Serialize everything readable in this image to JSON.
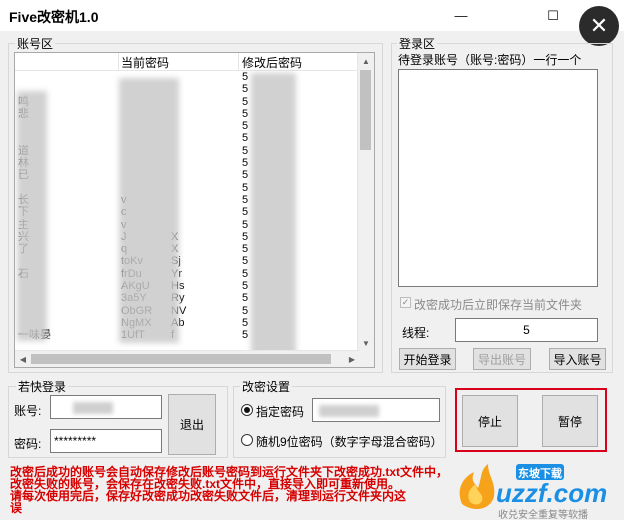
{
  "window": {
    "title": "Five改密机1.0",
    "minimize": "—",
    "maximize": "☐",
    "close": "✕"
  },
  "accounts_group": {
    "label": "账号区",
    "columns": [
      "",
      "当前密码",
      "修改后密码"
    ],
    "rows": [
      [
        "",
        "",
        "5"
      ],
      [
        "",
        "",
        "5"
      ],
      [
        "鸣",
        "",
        "5"
      ],
      [
        "悲",
        "",
        "5"
      ],
      [
        "",
        "",
        "5"
      ],
      [
        "",
        "",
        "5"
      ],
      [
        "道",
        "",
        "5"
      ],
      [
        "林",
        "",
        "5"
      ],
      [
        "已",
        "",
        "5"
      ],
      [
        "",
        "",
        "5"
      ],
      [
        "长",
        "v",
        "5"
      ],
      [
        "下",
        "c",
        "5"
      ],
      [
        "主",
        "v",
        "5"
      ],
      [
        "兴",
        "J",
        "5"
      ],
      [
        "了",
        "q",
        "5"
      ],
      [
        "",
        "toKv",
        "5"
      ],
      [
        "石",
        "frDu",
        "5"
      ],
      [
        "",
        "AKgU",
        "5"
      ],
      [
        "",
        "3a5Y",
        "5"
      ],
      [
        "",
        "ObGR",
        "5"
      ],
      [
        "",
        "NgMX",
        "5"
      ],
      [
        "一味晏",
        "1UfT",
        "5"
      ]
    ],
    "row_tails": [
      "",
      "",
      "",
      "",
      "",
      "",
      "",
      "",
      "",
      "",
      "",
      "",
      "",
      "X",
      "X",
      "Sj",
      "Yr",
      "Hs",
      "Ry",
      "NV",
      "Ab",
      "f"
    ]
  },
  "login_group": {
    "label": "登录区",
    "pending_label": "待登录账号（账号:密码）一行一个",
    "save_checkbox_label": "改密成功后立即保存当前文件夹",
    "save_checked": true,
    "threads_label": "线程:",
    "threads_value": "5",
    "start_login_button": "开始登录",
    "export_button": "导出账号",
    "import_button": "导入账号"
  },
  "quick_login": {
    "label": "若快登录",
    "account_label": "账号:",
    "password_label": "密码:",
    "password_value": "*********",
    "logout_button": "退出"
  },
  "password_settings": {
    "label": "改密设置",
    "specified_label": "指定密码",
    "random_label": "随机9位密码（数字字母混合密码）",
    "selected": "specified"
  },
  "controls": {
    "stop_button": "停止",
    "pause_button": "暂停"
  },
  "notice": {
    "lines": [
      "改密后成功的账号会自动保存修改后账号密码到运行文件夹下改密成功.txt文件中，",
      "改密失败的账号，会保存在改密失败.txt文件中，直接导入即可重新使用。",
      "请每次使用完后，保存好改密成功改密失败文件后，清理到运行文件夹内这",
      "误"
    ]
  },
  "watermark": {
    "brand": "uzzf.com",
    "tag": "东坡下载",
    "slogan": "收兑安全重复等软播"
  },
  "colors": {
    "accent_red": "#d9001b",
    "notice_red": "#d60000",
    "window_bg": "#f0f0f0"
  }
}
